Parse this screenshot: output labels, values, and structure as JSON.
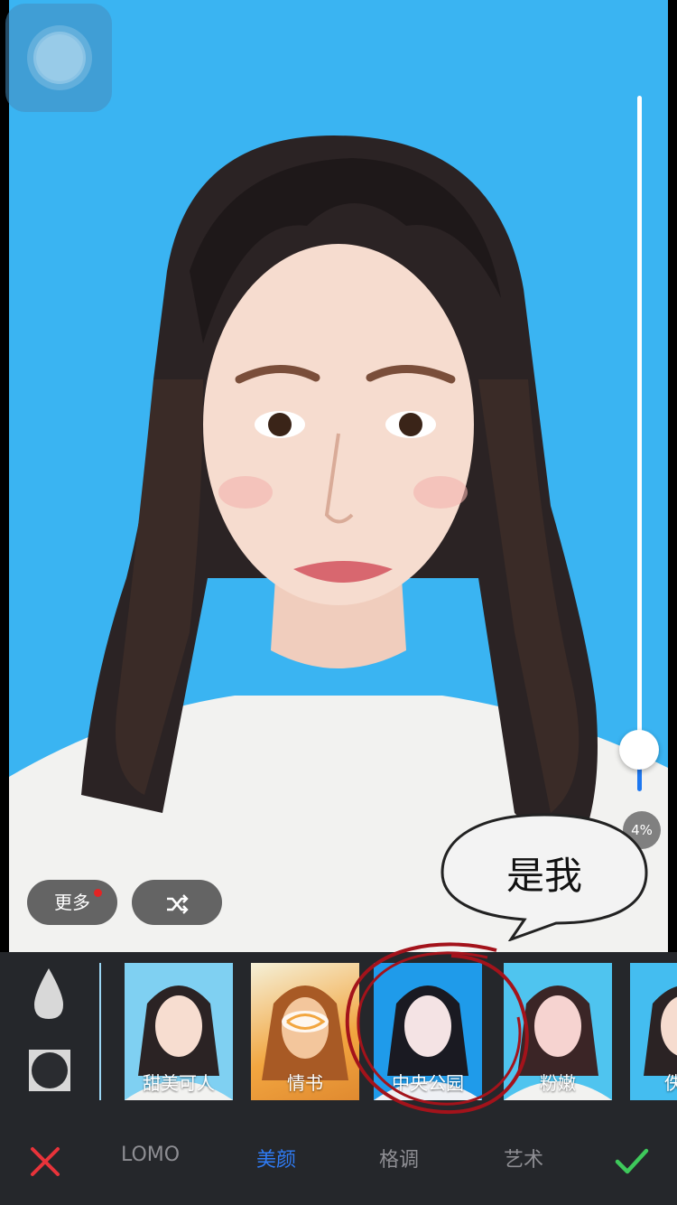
{
  "editor": {
    "slider": {
      "percent_label": "4%",
      "value": 0.04
    },
    "buttons": {
      "more_label": "更多",
      "shuffle_icon": "shuffle-icon"
    },
    "annotation": {
      "speech_text": "是我"
    }
  },
  "filters": {
    "items": [
      {
        "label": "甜美可人"
      },
      {
        "label": "情书"
      },
      {
        "label": "中央公园",
        "selected": true
      },
      {
        "label": "粉嫩"
      },
      {
        "label": "佚"
      }
    ]
  },
  "tabs": [
    {
      "label": "LOMO"
    },
    {
      "label": "美颜",
      "active": true
    },
    {
      "label": "格调"
    },
    {
      "label": "艺术"
    }
  ],
  "actions": {
    "cancel_icon": "close-icon",
    "confirm_icon": "check-icon"
  },
  "colors": {
    "photo_bg": "#3ab4f2",
    "accent": "#2f7cf6",
    "cancel": "#e8333a",
    "confirm": "#3ec95b",
    "toolbar": "#25272b"
  }
}
